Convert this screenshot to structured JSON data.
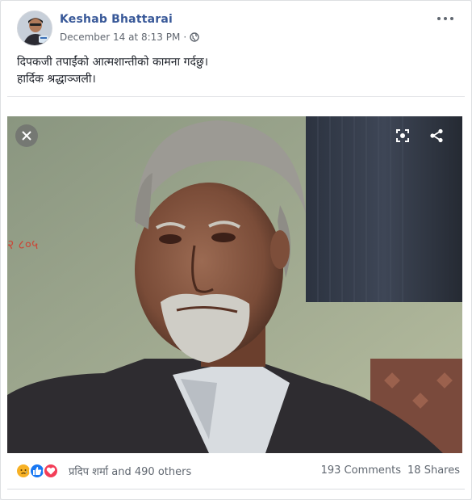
{
  "post": {
    "author": "Keshab Bhattarai",
    "timestamp": "December 14 at 8:13 PM",
    "separator": "·",
    "privacy_icon": "globe-icon",
    "text_line_1": "दिपकजी तपाईंको आत्मशान्तीको कामना गर्दछु।",
    "text_line_2": "हार्दिक श्रद्धाञ्जली।"
  },
  "video": {
    "overlay_stamp": "२ ८०५",
    "close_icon": "close-icon",
    "screen_icon": "fullscreen-icon",
    "share_icon": "share-icon"
  },
  "footer": {
    "reaction_icons": [
      "sad-reaction-icon",
      "like-reaction-icon",
      "love-reaction-icon"
    ],
    "reactors": "प्रदिप शर्मा and 490 others",
    "comments": "193 Comments",
    "shares": "18 Shares"
  },
  "colors": {
    "link_blue": "#385898",
    "like_blue": "#1877f2",
    "love_red": "#f33e58",
    "sad_yellow": "#f7b125"
  }
}
